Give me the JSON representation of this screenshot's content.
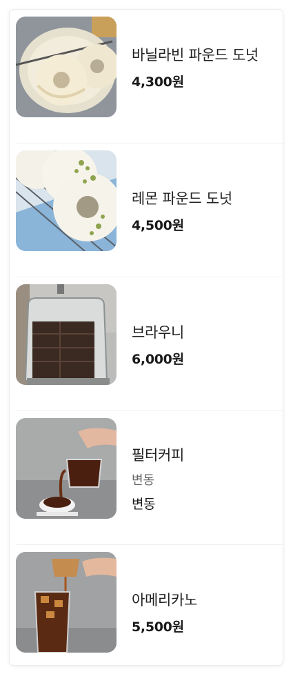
{
  "menu": {
    "items": [
      {
        "name": "바닐라빈 파운드 도넛",
        "price": "4,300원"
      },
      {
        "name": "레몬 파운드 도넛",
        "price": "4,500원"
      },
      {
        "name": "브라우니",
        "price": "6,000원"
      },
      {
        "name": "필터커피",
        "option": "변동",
        "price": "변동"
      },
      {
        "name": "아메리카노",
        "price": "5,500원"
      }
    ]
  }
}
